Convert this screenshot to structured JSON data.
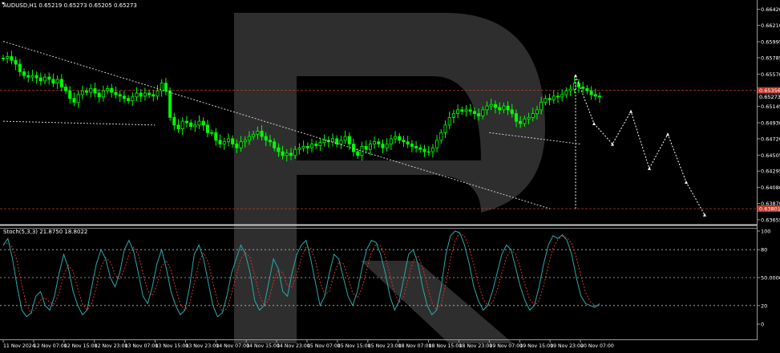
{
  "symbol_header": "AUDUSD,H1  0.65219 0.65273 0.65205 0.65273",
  "indicator_header": "Stoch(5,3,3) 21.8750 18.8022",
  "colors": {
    "background": "#000000",
    "bull_candle": "#00ff00",
    "bear_candle": "#00ff00",
    "trendline": "#cfcfcf",
    "level_line": "#c0392b",
    "stoch_main": "#2ea8a8",
    "stoch_signal": "#d93030",
    "axis_text": "#ffffff",
    "watermark": "#2e2e2e"
  },
  "price_axis": {
    "ticks": [
      "0.66420",
      "0.66210",
      "0.65995",
      "0.65785",
      "0.65570",
      "0.65360",
      "0.65145",
      "0.64930",
      "0.64720",
      "0.64505",
      "0.64295",
      "0.64080",
      "0.63870",
      "0.63655"
    ],
    "current_price": "0.65273",
    "level_high": "0.65356",
    "level_low": "0.63801"
  },
  "stoch_axis": {
    "ticks": [
      "100",
      "80",
      "50.0000",
      "20",
      "0"
    ]
  },
  "time_axis": {
    "labels": [
      "11 Nov 2024",
      "12 Nov 07:00",
      "12 Nov 15:00",
      "12 Nov 23:00",
      "13 Nov 07:00",
      "13 Nov 15:00",
      "13 Nov 23:00",
      "14 Nov 07:00",
      "14 Nov 15:00",
      "14 Nov 23:00",
      "15 Nov 07:00",
      "15 Nov 15:00",
      "15 Nov 23:00",
      "18 Nov 07:00",
      "18 Nov 15:00",
      "18 Nov 23:00",
      "19 Nov 07:00",
      "19 Nov 15:00",
      "19 Nov 23:00",
      "20 Nov 07:00"
    ]
  },
  "chart_data": {
    "type": "candlestick",
    "symbol": "AUDUSD",
    "timeframe": "H1",
    "ohlc_last": {
      "open": 0.65219,
      "high": 0.65273,
      "low": 0.65205,
      "close": 0.65273
    },
    "price_ylim": [
      0.6357,
      0.6648
    ],
    "close_series": [
      0.6578,
      0.658,
      0.6575,
      0.657,
      0.656,
      0.6555,
      0.6553,
      0.6555,
      0.6552,
      0.6548,
      0.6553,
      0.655,
      0.6545,
      0.655,
      0.654,
      0.6535,
      0.6525,
      0.652,
      0.653,
      0.6535,
      0.6533,
      0.6538,
      0.6532,
      0.6527,
      0.6535,
      0.6538,
      0.6533,
      0.653,
      0.6528,
      0.6525,
      0.6522,
      0.6527,
      0.6532,
      0.6528,
      0.6532,
      0.653,
      0.6528,
      0.6535,
      0.6545,
      0.6535,
      0.65,
      0.649,
      0.6485,
      0.6495,
      0.6493,
      0.6488,
      0.649,
      0.6495,
      0.649,
      0.648,
      0.648,
      0.647,
      0.6465,
      0.6468,
      0.6472,
      0.6465,
      0.646,
      0.6468,
      0.647,
      0.6475,
      0.6478,
      0.6482,
      0.6475,
      0.647,
      0.6468,
      0.646,
      0.6455,
      0.645,
      0.6453,
      0.645,
      0.6458,
      0.646,
      0.6462,
      0.646,
      0.6465,
      0.6463,
      0.6467,
      0.647,
      0.6468,
      0.6472,
      0.6465,
      0.647,
      0.6475,
      0.6465,
      0.6455,
      0.645,
      0.6462,
      0.6458,
      0.6465,
      0.6468,
      0.6465,
      0.646,
      0.6465,
      0.6472,
      0.6475,
      0.647,
      0.6468,
      0.6465,
      0.6462,
      0.646,
      0.6458,
      0.6455,
      0.6455,
      0.646,
      0.647,
      0.648,
      0.649,
      0.65,
      0.6505,
      0.651,
      0.6508,
      0.651,
      0.6508,
      0.6505,
      0.6502,
      0.651,
      0.6515,
      0.6517,
      0.6513,
      0.651,
      0.6515,
      0.651,
      0.6505,
      0.6495,
      0.6492,
      0.6498,
      0.65,
      0.6505,
      0.651,
      0.652,
      0.6525,
      0.6523,
      0.6528,
      0.6527,
      0.653,
      0.6535,
      0.6537,
      0.6545,
      0.654,
      0.6538,
      0.6535,
      0.653,
      0.6528,
      0.6527
    ],
    "trendlines": [
      {
        "from": [
          "11 Nov 2024",
          0.66
        ],
        "to": [
          "19 Nov 23:00",
          0.638
        ],
        "style": "dotted"
      },
      {
        "from": [
          "11 Nov 2024",
          0.6495
        ],
        "to": [
          "13 Nov 15:00",
          0.649
        ],
        "style": "dotted"
      },
      {
        "from": [
          "19 Nov 07:00",
          0.648
        ],
        "to": [
          "20 Nov 07:00",
          0.6465
        ],
        "style": "dotted"
      }
    ],
    "forecast_path": [
      0.6555,
      0.6492,
      0.6465,
      0.6508,
      0.6433,
      0.6478,
      0.6415,
      0.6372
    ],
    "horizontal_levels": [
      0.65356,
      0.63801
    ],
    "stoch": {
      "params": "5,3,3",
      "main_last": 21.875,
      "signal_last": 18.8022,
      "ylim": [
        0,
        100
      ],
      "levels": [
        80,
        50,
        20
      ],
      "main": [
        85,
        92,
        70,
        40,
        15,
        8,
        12,
        30,
        35,
        20,
        15,
        30,
        55,
        75,
        60,
        35,
        20,
        10,
        15,
        40,
        65,
        80,
        70,
        50,
        40,
        55,
        80,
        90,
        78,
        55,
        30,
        22,
        40,
        65,
        80,
        60,
        35,
        20,
        10,
        15,
        40,
        75,
        85,
        70,
        45,
        20,
        8,
        12,
        30,
        55,
        70,
        85,
        75,
        55,
        25,
        15,
        20,
        45,
        70,
        60,
        35,
        30,
        55,
        75,
        85,
        90,
        70,
        45,
        20,
        30,
        55,
        75,
        70,
        50,
        30,
        20,
        35,
        60,
        80,
        90,
        88,
        75,
        55,
        30,
        15,
        25,
        50,
        75,
        80,
        65,
        40,
        20,
        10,
        15,
        40,
        75,
        95,
        100,
        98,
        85,
        65,
        40,
        25,
        15,
        20,
        35,
        55,
        75,
        85,
        80,
        60,
        40,
        25,
        15,
        20,
        40,
        65,
        85,
        95,
        92,
        96,
        90,
        75,
        50,
        30,
        22,
        20,
        18,
        22
      ]
    }
  }
}
